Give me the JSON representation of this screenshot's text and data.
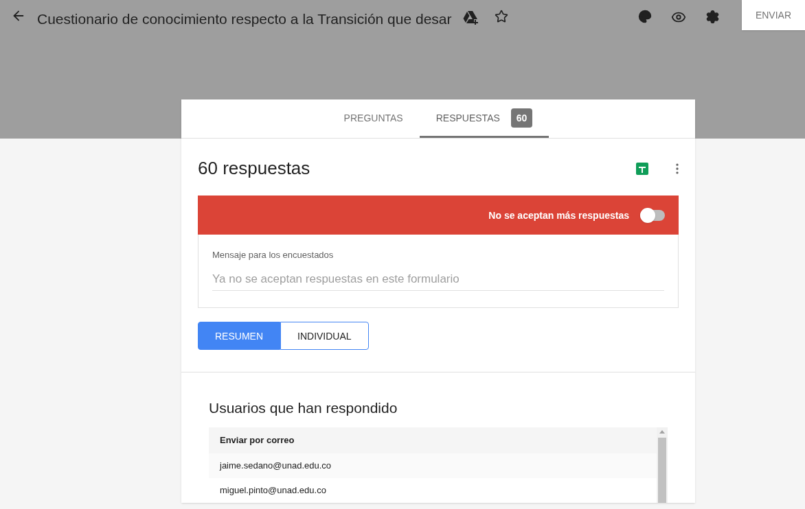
{
  "header": {
    "title": "Cuestionario de conocimiento respecto a la  Transición que desar",
    "send_button": "ENVIAR"
  },
  "tabs": [
    {
      "label": "PREGUNTAS",
      "selected": false
    },
    {
      "label": "RESPUESTAS",
      "selected": true,
      "badge": "60"
    }
  ],
  "summary": {
    "title": "60 respuestas"
  },
  "accepting": {
    "label": "No se aceptan más respuestas",
    "on": false
  },
  "message": {
    "label": "Mensaje para los encuestados",
    "placeholder": "Ya no se aceptan respuestas en este formulario"
  },
  "views": [
    {
      "label": "RESUMEN",
      "selected": true
    },
    {
      "label": "INDIVIDUAL",
      "selected": false
    }
  ],
  "respondents": {
    "title": "Usuarios que han respondido",
    "column": "Enviar por correo",
    "rows": [
      "jaime.sedano@unad.edu.co",
      "miguel.pinto@unad.edu.co"
    ]
  }
}
